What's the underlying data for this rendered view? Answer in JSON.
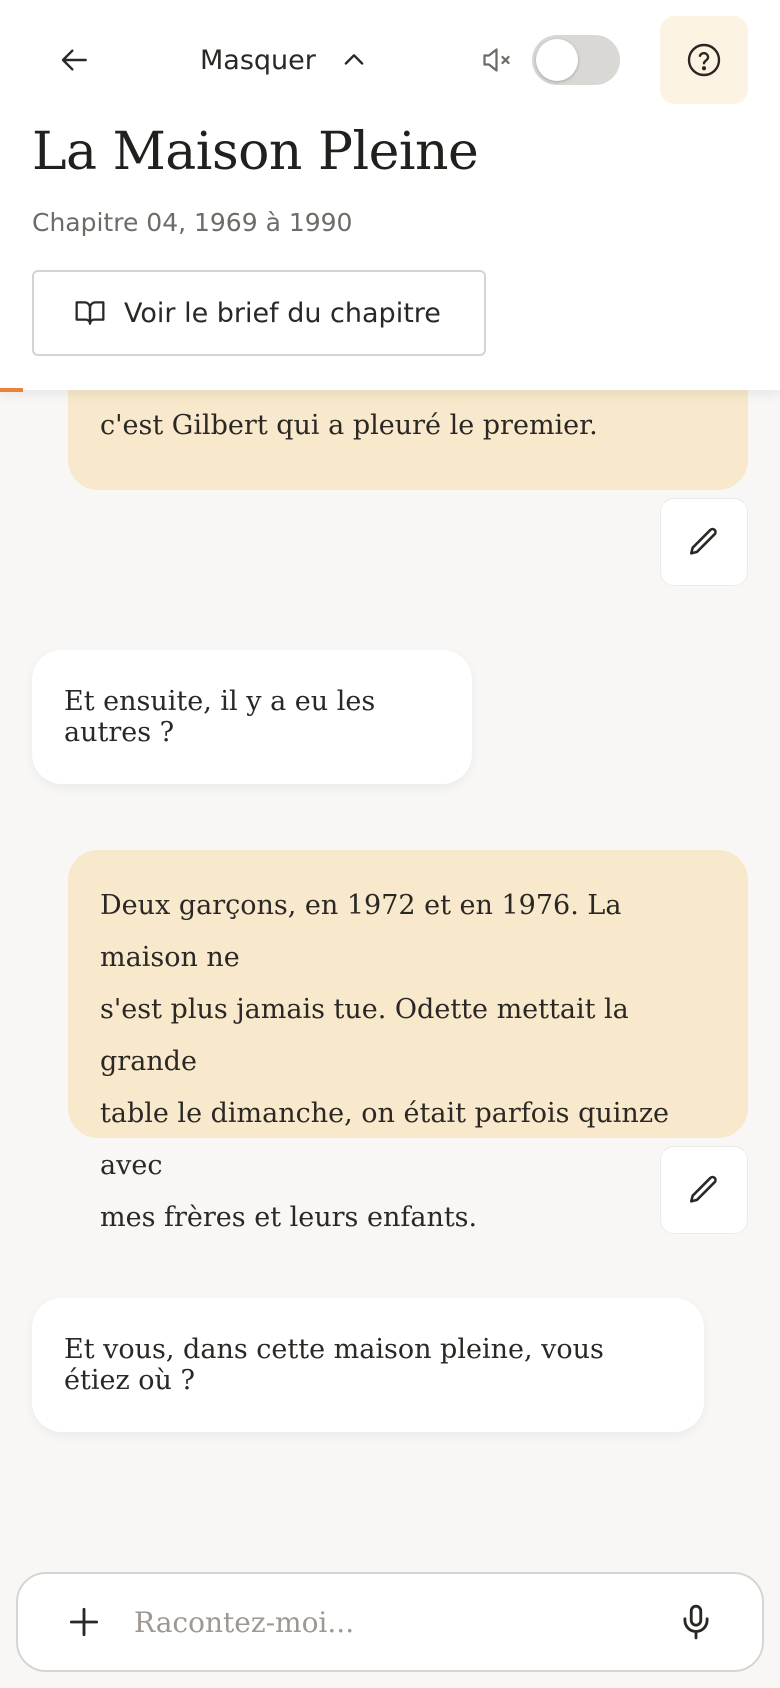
{
  "header": {
    "hide_label": "Masquer",
    "title": "La Maison Pleine",
    "subtitle": "Chapitre 04, 1969 à 1990",
    "brief_label": "Voir le brief du chapitre",
    "sound_enabled": false,
    "progress": 0.03
  },
  "messages": [
    {
      "role": "user",
      "text": "c'est Gilbert qui a pleuré le premier."
    },
    {
      "role": "assistant",
      "text": "Et ensuite, il y a eu les autres ?"
    },
    {
      "role": "user",
      "lines": [
        "Deux garçons, en 1972 et en 1976. La maison ne",
        "s'est plus jamais tue. Odette mettait la grande",
        "table le dimanche, on était parfois quinze avec",
        "mes frères et leurs enfants."
      ]
    },
    {
      "role": "assistant",
      "text": "Et vous, dans cette maison pleine, vous étiez où ?"
    }
  ],
  "composer": {
    "placeholder": "Racontez-moi..."
  },
  "icons": {
    "back": "arrow-left-icon",
    "hide": "chevron-up-icon",
    "mute": "speaker-muted-icon",
    "help": "question-circle-icon",
    "brief": "open-book-icon",
    "edit": "pencil-icon",
    "add": "plus-icon",
    "mic": "microphone-icon"
  },
  "colors": {
    "accent": "#e8843a",
    "user_bubble": "#f8e9cc",
    "help_bg": "#fdf3e3"
  }
}
